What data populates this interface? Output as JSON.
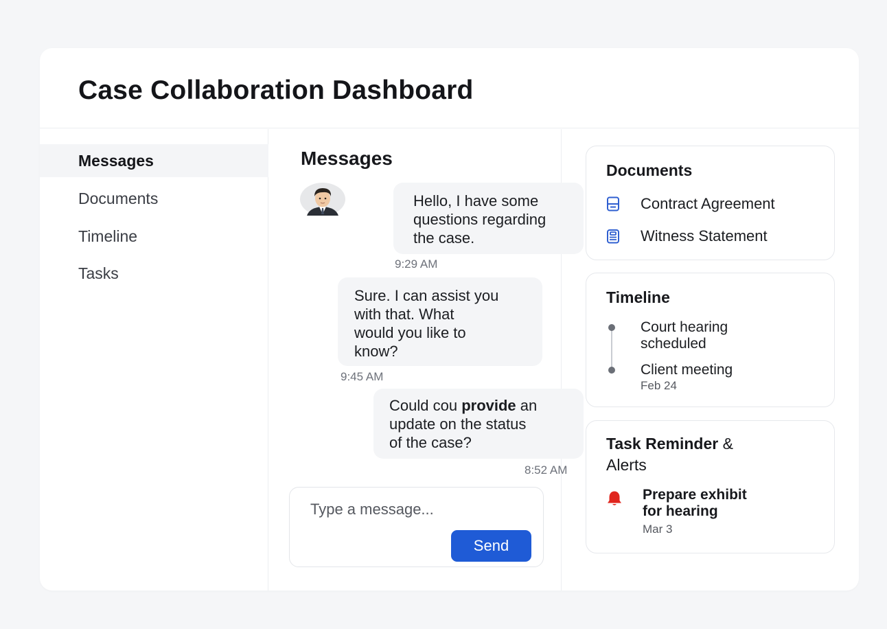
{
  "header": {
    "title": "Case Collaboration Dashboard"
  },
  "sidebar": {
    "items": [
      {
        "label": "Messages",
        "active": true
      },
      {
        "label": "Documents",
        "active": false
      },
      {
        "label": "Timeline",
        "active": false
      },
      {
        "label": "Tasks",
        "active": false
      }
    ]
  },
  "messages": {
    "title": "Messages",
    "list": [
      {
        "text": "Hello, I have some\nquestions regarding\nthe case.",
        "time": "9:29 AM",
        "has_avatar": true
      },
      {
        "text": "Sure. I can assist you\nwith that. What\nwould you like to\nknow?",
        "time": "9:45 AM"
      },
      {
        "text_parts": [
          "Could cou ",
          "provide",
          " an\nupdate on the status\nof the case?"
        ],
        "time": "8:52 AM"
      }
    ],
    "composer": {
      "placeholder": "Type a message...",
      "value": "",
      "send_label": "Send"
    }
  },
  "documents": {
    "title": "Documents",
    "items": [
      {
        "label": "Contract Agreement",
        "icon": "document-icon"
      },
      {
        "label": "Witness Statement",
        "icon": "clipboard-icon"
      }
    ]
  },
  "timeline": {
    "title": "Timeline",
    "items": [
      {
        "label": "Court hearing\nscheduled",
        "date": ""
      },
      {
        "label": "Client meeting",
        "date": "Feb 24"
      }
    ]
  },
  "tasks": {
    "title_bold": "Task Reminder",
    "title_rest": " &\nAlerts",
    "items": [
      {
        "label": "Prepare exhibit\nfor hearing",
        "date": "Mar 3",
        "icon": "bell-icon"
      }
    ]
  },
  "colors": {
    "accent": "#1f5bd6",
    "alert": "#e0261e",
    "doc_icon": "#2f5fd0"
  }
}
